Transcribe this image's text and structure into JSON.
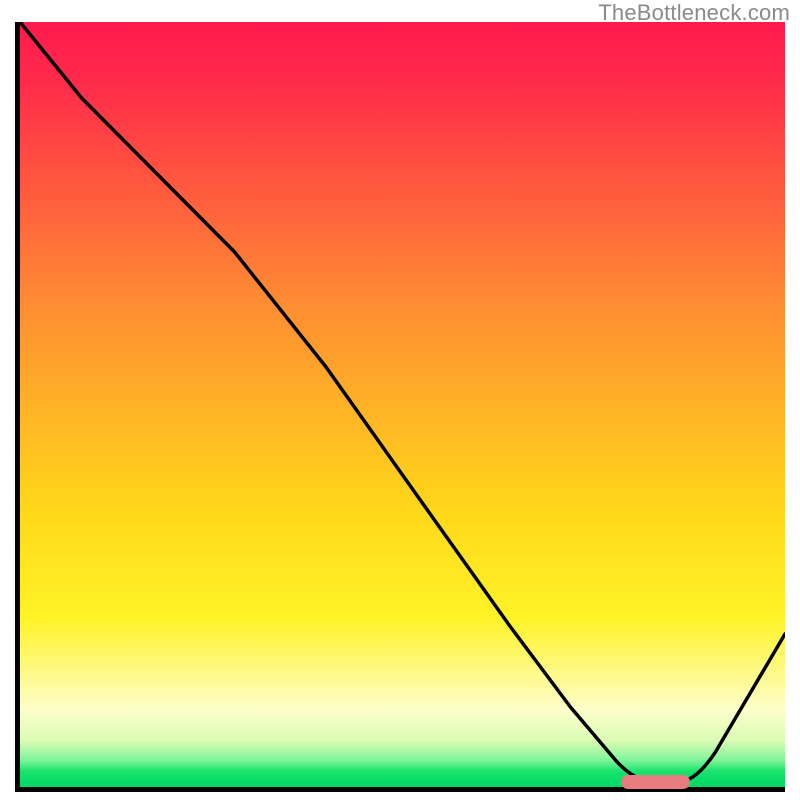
{
  "watermark": "TheBottleneck.com",
  "chart_data": {
    "type": "line",
    "title": "",
    "xlabel": "",
    "ylabel": "",
    "xlim": [
      0,
      100
    ],
    "ylim": [
      0,
      100
    ],
    "series": [
      {
        "name": "bottleneck-curve",
        "x": [
          0,
          8,
          20,
          28,
          40,
          52,
          64,
          72,
          78,
          83,
          86,
          100
        ],
        "y": [
          100,
          90,
          78,
          72,
          55,
          38,
          21,
          9,
          2,
          0,
          0,
          20
        ]
      }
    ],
    "marker": {
      "x_start": 78,
      "x_end": 87,
      "y": 0,
      "color": "#e77b7f"
    },
    "gradient_stops": [
      {
        "pos": 0,
        "color": "#ff1a4d"
      },
      {
        "pos": 0.5,
        "color": "#ffb126"
      },
      {
        "pos": 0.78,
        "color": "#fff327"
      },
      {
        "pos": 0.98,
        "color": "#17e36b"
      },
      {
        "pos": 1.0,
        "color": "#00d864"
      }
    ]
  }
}
